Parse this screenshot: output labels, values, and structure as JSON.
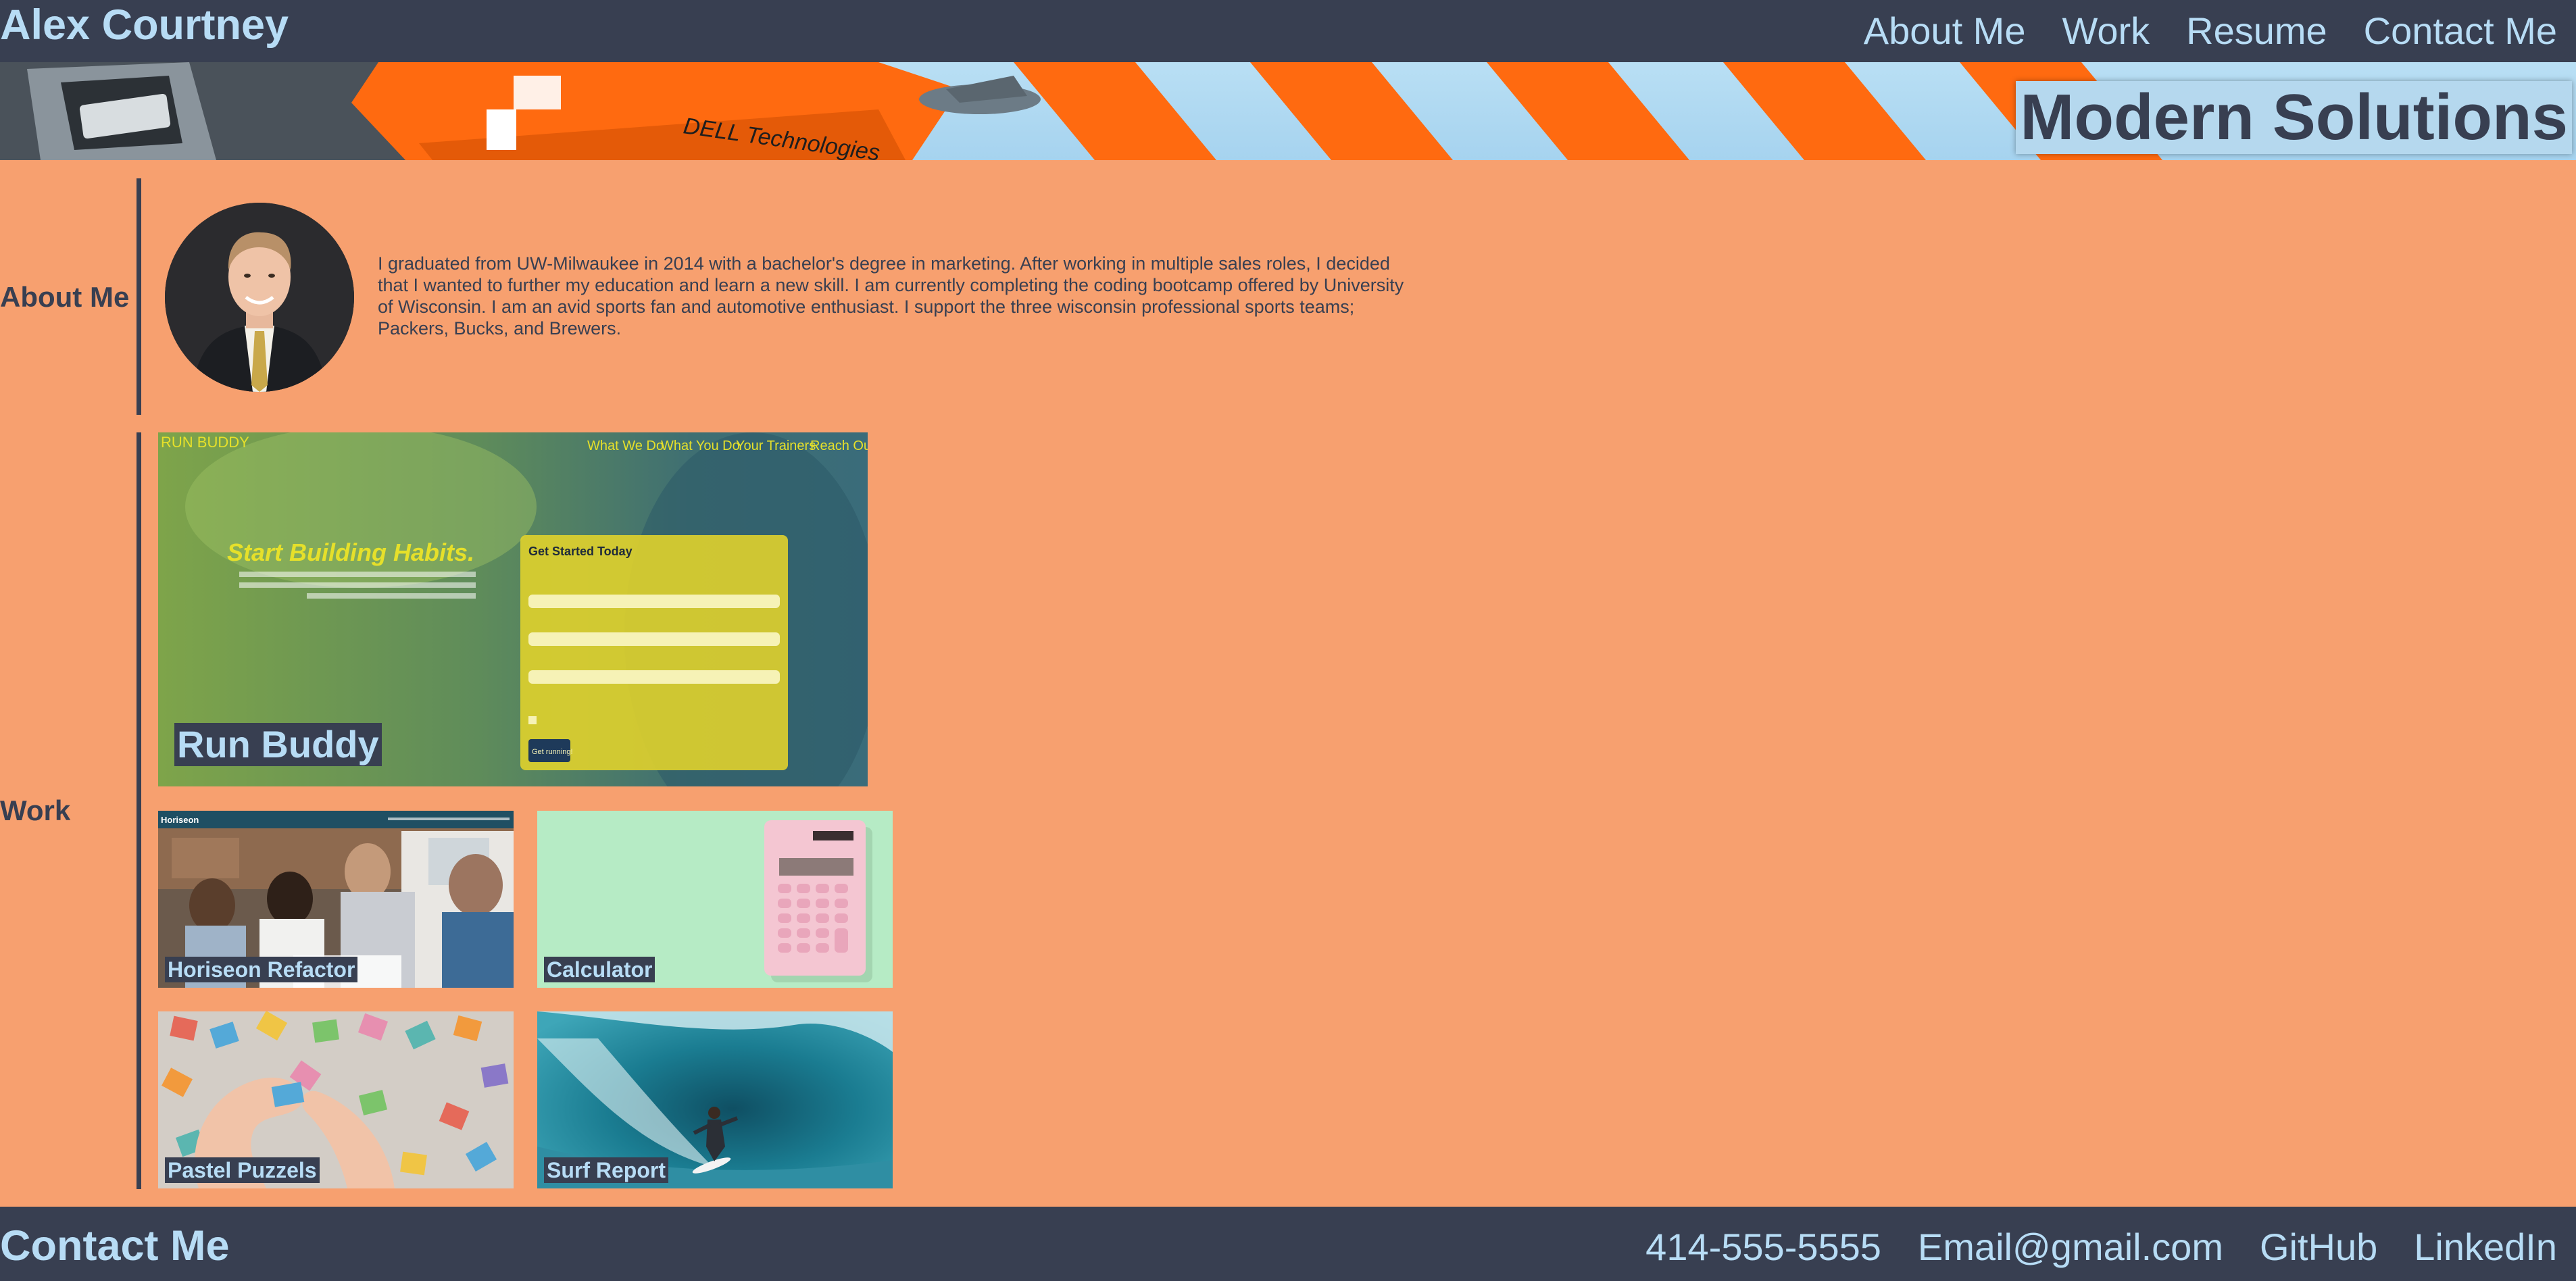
{
  "header": {
    "name": "Alex Courtney",
    "nav": [
      "About Me",
      "Work",
      "Resume",
      "Contact Me"
    ]
  },
  "banner": {
    "tagline": "Modern Solutions",
    "sponsor_text": "DELL Technologies"
  },
  "about": {
    "label": "About Me",
    "text": "I graduated from UW-Milwaukee in 2014 with a bachelor's degree in marketing. After working in multiple sales roles, I decided that I wanted to further my education and learn a new skill. I am currently completing the coding bootcamp offered by University of Wisconsin. I am an avid sports fan and automotive enthusiast. I support the three wisconsin professional sports teams; Packers, Bucks, and Brewers."
  },
  "work": {
    "label": "Work",
    "featured": {
      "label": "Run Buddy",
      "screenshot": {
        "brand": "RUN BUDDY",
        "nav": [
          "What We Do",
          "What You Do",
          "Your Trainers",
          "Reach Out"
        ],
        "headline": "Start Building Habits.",
        "form_title": "Get Started Today",
        "button": "Get running!"
      }
    },
    "projects": [
      {
        "label": "Horiseon Refactor",
        "brand": "Horiseon"
      },
      {
        "label": "Calculator"
      },
      {
        "label": "Pastel Puzzels"
      },
      {
        "label": "Surf Report"
      }
    ]
  },
  "footer": {
    "title": "Contact Me",
    "links": [
      "414-555-5555",
      "Email@gmail.com",
      "GitHub",
      "LinkedIn"
    ]
  },
  "colors": {
    "dark": "#383f51",
    "light_blue": "#b7dcf5",
    "background": "#f7a06f"
  }
}
